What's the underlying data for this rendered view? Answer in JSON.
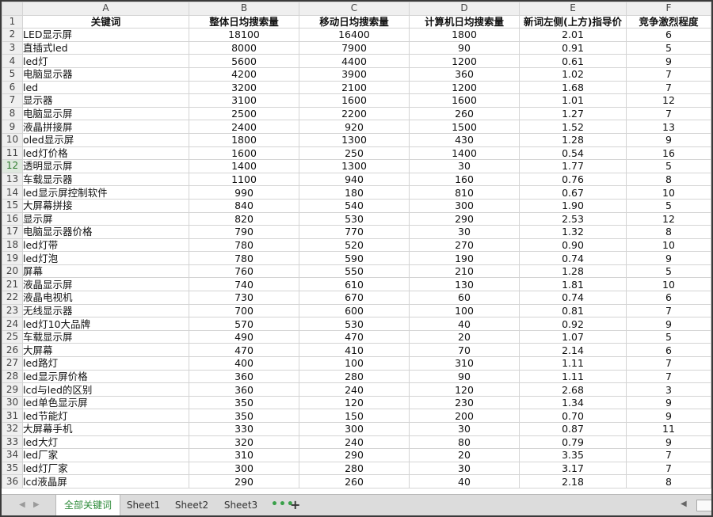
{
  "columns": [
    "A",
    "B",
    "C",
    "D",
    "E",
    "F"
  ],
  "header_row": {
    "row_number": "1",
    "cells": [
      "关键词",
      "整体日均搜索量",
      "移动日均搜索量",
      "计算机日均搜索量",
      "新词左侧(上方)指导价",
      "竞争激烈程度"
    ]
  },
  "rows": [
    {
      "n": "2",
      "kw": "LED显示屏",
      "total": "18100",
      "mobile": "16400",
      "pc": "1800",
      "price": "2.01",
      "comp": "6"
    },
    {
      "n": "3",
      "kw": "直插式led",
      "total": "8000",
      "mobile": "7900",
      "pc": "90",
      "price": "0.91",
      "comp": "5"
    },
    {
      "n": "4",
      "kw": "led灯",
      "total": "5600",
      "mobile": "4400",
      "pc": "1200",
      "price": "0.61",
      "comp": "9"
    },
    {
      "n": "5",
      "kw": "电脑显示器",
      "total": "4200",
      "mobile": "3900",
      "pc": "360",
      "price": "1.02",
      "comp": "7"
    },
    {
      "n": "6",
      "kw": "led",
      "total": "3200",
      "mobile": "2100",
      "pc": "1200",
      "price": "1.68",
      "comp": "7"
    },
    {
      "n": "7",
      "kw": "显示器",
      "total": "3100",
      "mobile": "1600",
      "pc": "1600",
      "price": "1.01",
      "comp": "12"
    },
    {
      "n": "8",
      "kw": "电脑显示屏",
      "total": "2500",
      "mobile": "2200",
      "pc": "260",
      "price": "1.27",
      "comp": "7"
    },
    {
      "n": "9",
      "kw": "液晶拼接屏",
      "total": "2400",
      "mobile": "920",
      "pc": "1500",
      "price": "1.52",
      "comp": "13"
    },
    {
      "n": "10",
      "kw": "oled显示屏",
      "total": "1800",
      "mobile": "1300",
      "pc": "430",
      "price": "1.28",
      "comp": "9"
    },
    {
      "n": "11",
      "kw": "led灯价格",
      "total": "1600",
      "mobile": "250",
      "pc": "1400",
      "price": "0.54",
      "comp": "16"
    },
    {
      "n": "12",
      "kw": "透明显示屏",
      "total": "1400",
      "mobile": "1300",
      "pc": "30",
      "price": "1.77",
      "comp": "5"
    },
    {
      "n": "13",
      "kw": "车载显示器",
      "total": "1100",
      "mobile": "940",
      "pc": "160",
      "price": "0.76",
      "comp": "8"
    },
    {
      "n": "14",
      "kw": "led显示屏控制软件",
      "total": "990",
      "mobile": "180",
      "pc": "810",
      "price": "0.67",
      "comp": "10"
    },
    {
      "n": "15",
      "kw": "大屏幕拼接",
      "total": "840",
      "mobile": "540",
      "pc": "300",
      "price": "1.90",
      "comp": "5"
    },
    {
      "n": "16",
      "kw": "显示屏",
      "total": "820",
      "mobile": "530",
      "pc": "290",
      "price": "2.53",
      "comp": "12"
    },
    {
      "n": "17",
      "kw": "电脑显示器价格",
      "total": "790",
      "mobile": "770",
      "pc": "30",
      "price": "1.32",
      "comp": "8"
    },
    {
      "n": "18",
      "kw": "led灯带",
      "total": "780",
      "mobile": "520",
      "pc": "270",
      "price": "0.90",
      "comp": "10"
    },
    {
      "n": "19",
      "kw": "led灯泡",
      "total": "780",
      "mobile": "590",
      "pc": "190",
      "price": "0.74",
      "comp": "9"
    },
    {
      "n": "20",
      "kw": "屏幕",
      "total": "760",
      "mobile": "550",
      "pc": "210",
      "price": "1.28",
      "comp": "5"
    },
    {
      "n": "21",
      "kw": "液晶显示屏",
      "total": "740",
      "mobile": "610",
      "pc": "130",
      "price": "1.81",
      "comp": "10"
    },
    {
      "n": "22",
      "kw": "液晶电视机",
      "total": "730",
      "mobile": "670",
      "pc": "60",
      "price": "0.74",
      "comp": "6"
    },
    {
      "n": "23",
      "kw": "无线显示器",
      "total": "700",
      "mobile": "600",
      "pc": "100",
      "price": "0.81",
      "comp": "7"
    },
    {
      "n": "24",
      "kw": "led灯10大品牌",
      "total": "570",
      "mobile": "530",
      "pc": "40",
      "price": "0.92",
      "comp": "9"
    },
    {
      "n": "25",
      "kw": "车载显示屏",
      "total": "490",
      "mobile": "470",
      "pc": "20",
      "price": "1.07",
      "comp": "5"
    },
    {
      "n": "26",
      "kw": "大屏幕",
      "total": "470",
      "mobile": "410",
      "pc": "70",
      "price": "2.14",
      "comp": "6"
    },
    {
      "n": "27",
      "kw": "led路灯",
      "total": "400",
      "mobile": "100",
      "pc": "310",
      "price": "1.11",
      "comp": "7"
    },
    {
      "n": "28",
      "kw": "led显示屏价格",
      "total": "360",
      "mobile": "280",
      "pc": "90",
      "price": "1.11",
      "comp": "7"
    },
    {
      "n": "29",
      "kw": "lcd与led的区别",
      "total": "360",
      "mobile": "240",
      "pc": "120",
      "price": "2.68",
      "comp": "3"
    },
    {
      "n": "30",
      "kw": "led单色显示屏",
      "total": "350",
      "mobile": "120",
      "pc": "230",
      "price": "1.34",
      "comp": "9"
    },
    {
      "n": "31",
      "kw": "led节能灯",
      "total": "350",
      "mobile": "150",
      "pc": "200",
      "price": "0.70",
      "comp": "9"
    },
    {
      "n": "32",
      "kw": "大屏幕手机",
      "total": "330",
      "mobile": "300",
      "pc": "30",
      "price": "0.87",
      "comp": "11"
    },
    {
      "n": "33",
      "kw": "led大灯",
      "total": "320",
      "mobile": "240",
      "pc": "80",
      "price": "0.79",
      "comp": "9"
    },
    {
      "n": "34",
      "kw": "led厂家",
      "total": "310",
      "mobile": "290",
      "pc": "20",
      "price": "3.35",
      "comp": "7"
    },
    {
      "n": "35",
      "kw": "led灯厂家",
      "total": "300",
      "mobile": "280",
      "pc": "30",
      "price": "3.17",
      "comp": "7"
    },
    {
      "n": "36",
      "kw": "lcd液晶屏",
      "total": "290",
      "mobile": "260",
      "pc": "40",
      "price": "2.18",
      "comp": "8"
    }
  ],
  "selected_row": "12",
  "sheet_tabs": [
    {
      "label": "全部关键词",
      "active": true
    },
    {
      "label": "Sheet1",
      "active": false
    },
    {
      "label": "Sheet2",
      "active": false
    },
    {
      "label": "Sheet3",
      "active": false
    }
  ],
  "more_tabs_label": "•••",
  "add_sheet_label": "+",
  "nav_glyphs": {
    "first": "◀",
    "next": "▶",
    "scroll_left": "◀"
  },
  "colors": {
    "accent": "#2e8b3a",
    "header_bg": "#efefef",
    "grid_line": "#d4d4d4",
    "tabbar_bg": "#dcdcdc"
  }
}
